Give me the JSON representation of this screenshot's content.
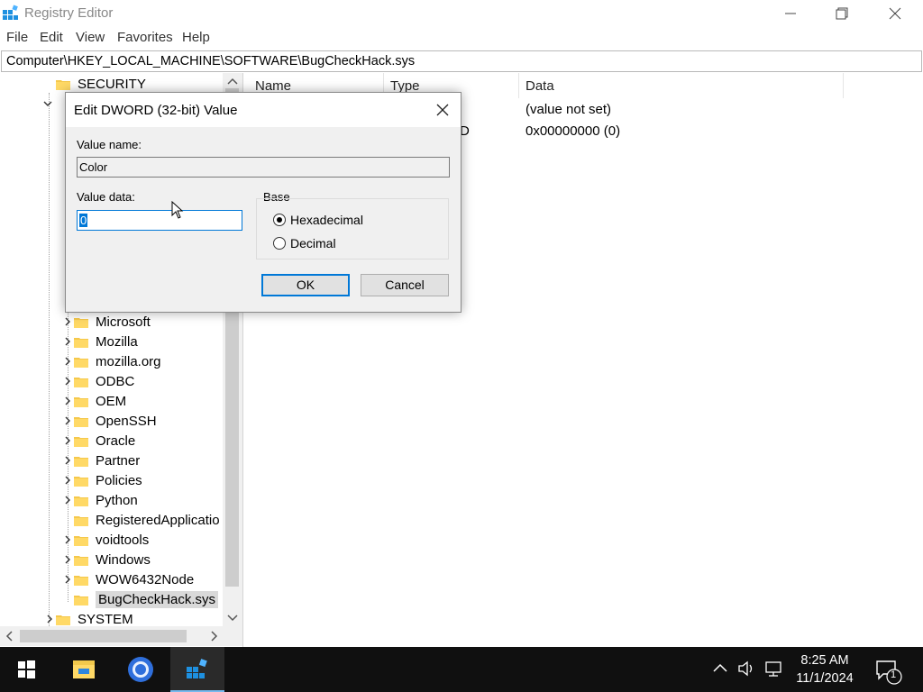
{
  "window": {
    "title": "Registry Editor",
    "icon": "registry-icon"
  },
  "menu": [
    "File",
    "Edit",
    "View",
    "Favorites",
    "Help"
  ],
  "address": "Computer\\HKEY_LOCAL_MACHINE\\SOFTWARE\\BugCheckHack.sys",
  "tree": {
    "top_items": [
      {
        "label": "SECURITY"
      }
    ],
    "items": [
      {
        "label": "Microsoft"
      },
      {
        "label": "Mozilla"
      },
      {
        "label": "mozilla.org"
      },
      {
        "label": "ODBC"
      },
      {
        "label": "OEM"
      },
      {
        "label": "OpenSSH"
      },
      {
        "label": "Oracle"
      },
      {
        "label": "Partner"
      },
      {
        "label": "Policies"
      },
      {
        "label": "Python"
      },
      {
        "label": "RegisteredApplicatio"
      },
      {
        "label": "voidtools"
      },
      {
        "label": "Windows"
      },
      {
        "label": "WOW6432Node"
      },
      {
        "label": "BugCheckHack.sys"
      }
    ],
    "bottom_items": [
      {
        "label": "SYSTEM"
      }
    ],
    "selected": "BugCheckHack.sys"
  },
  "list": {
    "columns": [
      "Name",
      "Type",
      "Data"
    ],
    "rows": [
      {
        "type_tail": "",
        "data": "(value not set)"
      },
      {
        "type_tail": "D",
        "data": "0x00000000 (0)"
      }
    ]
  },
  "dialog": {
    "title": "Edit DWORD (32-bit) Value",
    "value_name_label": "Value name:",
    "value_name": "Color",
    "value_data_label": "Value data:",
    "value_data": "0",
    "base_label": "Base",
    "radio_hex": "Hexadecimal",
    "radio_dec": "Decimal",
    "selected_base": "Hexadecimal",
    "ok": "OK",
    "cancel": "Cancel"
  },
  "taskbar": {
    "icons": [
      "windows-start-icon",
      "file-explorer-icon",
      "chrome-icon",
      "registry-editor-icon"
    ],
    "tray": [
      "chevron-up-icon",
      "volume-icon",
      "network-icon"
    ],
    "time": "8:25 AM",
    "date": "11/1/2024",
    "notifications": "1"
  },
  "colors": {
    "accent": "#0078d7",
    "taskbar": "#101010",
    "dialog_bg": "#f0f0f0"
  }
}
